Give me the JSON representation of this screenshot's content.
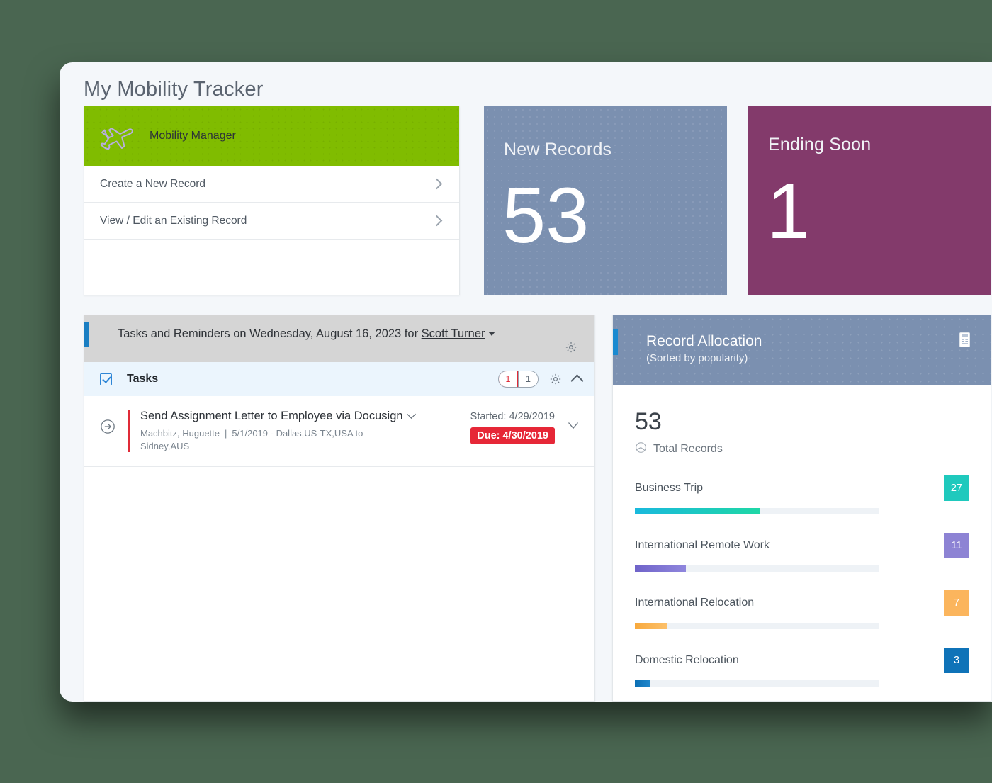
{
  "page": {
    "title": "My Mobility Tracker",
    "background_color": "#4a6651",
    "surface_color": "#f4f7fa"
  },
  "mobility_panel": {
    "header_label": "Mobility Manager",
    "header_color": "#80bc00",
    "icon": "airplane-icon",
    "menu_items": [
      {
        "label": "Create a New Record",
        "icon": "chevron-right-icon"
      },
      {
        "label": "View / Edit an Existing Record",
        "icon": "chevron-right-icon"
      }
    ]
  },
  "kpi_tiles": [
    {
      "label": "New Records",
      "value": "53",
      "color": "#7b90b0"
    },
    {
      "label": "Ending Soon",
      "value": "1",
      "color": "#833a6b"
    }
  ],
  "tasks_panel": {
    "header_text_before": "Tasks and Reminders on Wednesday, August 16, 2023 for ",
    "header_user": "Scott Turner",
    "header_gear_icon": "gear-icon",
    "accent_color": "#1a7ec2",
    "section": {
      "label": "Tasks",
      "checkbox_checked": true,
      "overdue_count": "1",
      "total_count": "1",
      "gear_icon": "gear-icon",
      "collapse_icon": "chevron-up-icon"
    },
    "rows": [
      {
        "title": "Send Assignment Letter to Employee via Docusign",
        "employee": "Machbitz, Huguette",
        "separator": "|",
        "detail": "5/1/2019 - Dallas,US-TX,USA to Sidney,AUS",
        "started": "Started: 4/29/2019",
        "due": "Due: 4/30/2019",
        "due_color": "#e62737",
        "go_icon": "arrow-right-circle-icon",
        "expand_icon": "caret-down-icon"
      }
    ]
  },
  "allocation_panel": {
    "title": "Record Allocation",
    "subtitle": "(Sorted by popularity)",
    "report_icon": "report-document-icon",
    "header_color": "#7b90b0",
    "accent_color": "#1a8ad0",
    "total_value": "53",
    "total_label": "Total Records",
    "total_icon": "pie-chart-icon"
  },
  "chart_data": {
    "type": "bar",
    "title": "Record Allocation",
    "subtitle": "(Sorted by popularity)",
    "orientation": "horizontal",
    "total": 53,
    "total_label": "Total Records",
    "xlabel": "",
    "ylabel": "",
    "grid": false,
    "legend": "none",
    "axis_max": 53,
    "categories": [
      "Business Trip",
      "International Remote Work",
      "International Relocation",
      "Domestic Relocation"
    ],
    "values": [
      27,
      11,
      7,
      3
    ],
    "percent_of_track": [
      51,
      21,
      13,
      6
    ],
    "colors": [
      "#1cc8c0",
      "#7d6fd0",
      "#f8b04e",
      "#0f73b8"
    ],
    "bar_gradients": [
      "linear-gradient(90deg,#19b9dd 0%,#1fd7a6 100%)",
      "linear-gradient(90deg,#6f63c9 0%,#8f86dd 100%)",
      "linear-gradient(90deg,#f8a93c 0%,#fcc06a 100%)",
      "linear-gradient(90deg,#0c6fb4 0%,#1f86cb 100%)"
    ],
    "badge_colors": [
      "#1fc9bd",
      "#8d83d4",
      "#fbb55d",
      "#0f73b8"
    ],
    "badge_labels": [
      "27",
      "11",
      "7",
      "3"
    ]
  }
}
